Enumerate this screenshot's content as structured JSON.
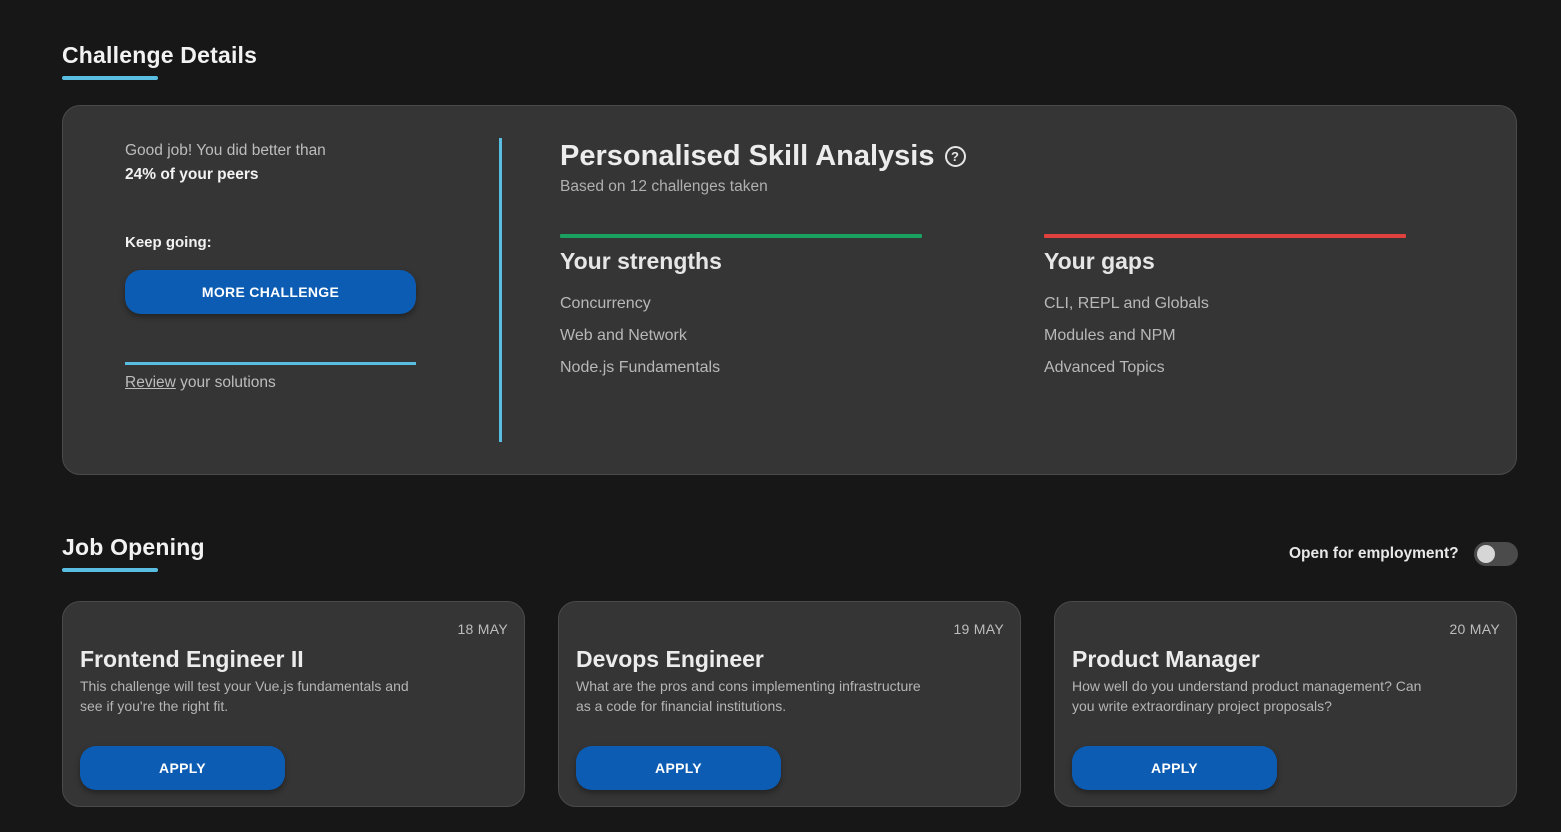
{
  "challenge": {
    "section_title": "Challenge Details",
    "peer_text": "Good job! You did better than",
    "peer_highlight": "24% of your peers",
    "keep_going": "Keep going:",
    "more_button": "MORE CHALLENGE",
    "review_link": "Review",
    "review_rest": " your solutions"
  },
  "analysis": {
    "title": "Personalised Skill Analysis",
    "help_icon": "question-circle-icon",
    "subtitle": "Based on 12 challenges taken",
    "strengths": {
      "heading": "Your strengths",
      "color": "#1aa15f",
      "items": [
        "Concurrency",
        "Web and Network",
        "Node.js Fundamentals"
      ]
    },
    "gaps": {
      "heading": "Your gaps",
      "color": "#e0413c",
      "items": [
        "CLI, REPL and Globals",
        "Modules and NPM",
        "Advanced Topics"
      ]
    }
  },
  "jobs": {
    "section_title": "Job Opening",
    "toggle_label": "Open for employment?",
    "toggle_on": false,
    "cards": [
      {
        "date": "18 MAY",
        "title": "Frontend Engineer II",
        "description": "This challenge will test your Vue.js fundamentals and see if you're the right fit.",
        "button": "APPLY"
      },
      {
        "date": "19 MAY",
        "title": "Devops Engineer",
        "description": "What are the pros and cons implementing infrastructure as a code for financial institutions.",
        "button": "APPLY"
      },
      {
        "date": "20 MAY",
        "title": "Product Manager",
        "description": "How well do you understand product management? Can you write extraordinary project proposals?",
        "button": "APPLY"
      }
    ]
  },
  "colors": {
    "accent": "#58bde0",
    "button": "#0c5cb3",
    "background": "#171717",
    "card": "#353535"
  }
}
